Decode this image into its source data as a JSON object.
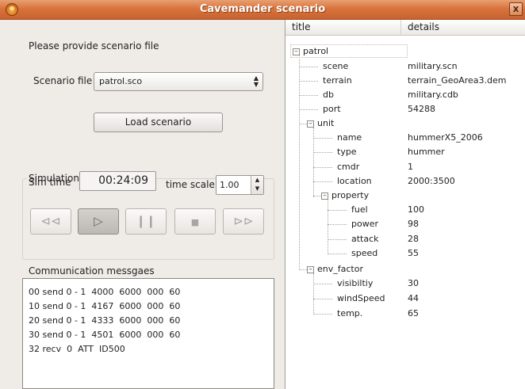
{
  "window": {
    "title": "Cavemander scenario",
    "close_label": "x"
  },
  "left": {
    "prompt": "Please provide scenario file",
    "scenario_label": "Scenario file",
    "scenario_value": "patrol.sco",
    "load_button": "Load scenario",
    "player_title": "Simulation player",
    "sim_time_label": "Sim time",
    "sim_time_value": "00:24:09",
    "time_scale_label": "time scale",
    "time_scale_value": "1.00",
    "comm_title": "Communication messgaes",
    "log_lines": [
      "00 send 0 - 1  4000  6000  000  60",
      "10 send 0 - 1  4167  6000  000  60",
      "20 send 0 - 1  4333  6000  000  60",
      "30 send 0 - 1  4501  6000  000  60",
      "32 recv  0  ATT  ID500"
    ]
  },
  "tree": {
    "headers": {
      "title": "title",
      "details": "details"
    },
    "nodes": {
      "patrol": {
        "title": "patrol",
        "details": ""
      },
      "scene": {
        "title": "scene",
        "details": "military.scn"
      },
      "terrain": {
        "title": "terrain",
        "details": "terrain_GeoArea3.dem"
      },
      "db": {
        "title": "db",
        "details": "military.cdb"
      },
      "port": {
        "title": "port",
        "details": "54288"
      },
      "unit": {
        "title": "unit",
        "details": ""
      },
      "name": {
        "title": "name",
        "details": "hummerX5_2006"
      },
      "type": {
        "title": "type",
        "details": "hummer"
      },
      "cmdr": {
        "title": "cmdr",
        "details": "1"
      },
      "location": {
        "title": "location",
        "details": "2000:3500"
      },
      "property": {
        "title": "property",
        "details": ""
      },
      "fuel": {
        "title": "fuel",
        "details": "100"
      },
      "power": {
        "title": "power",
        "details": "98"
      },
      "attack": {
        "title": "attack",
        "details": "28"
      },
      "speed": {
        "title": "speed",
        "details": "55"
      },
      "env_factor": {
        "title": "env_factor",
        "details": ""
      },
      "visibility": {
        "title": "visibiltiy",
        "details": "30"
      },
      "windspeed": {
        "title": "windSpeed",
        "details": "44"
      },
      "temp": {
        "title": "temp.",
        "details": "65"
      }
    }
  },
  "icons": {
    "rewind": "⊲⊲",
    "play": "▷",
    "pause": "❙❙",
    "stop": "■",
    "fast_forward": "⊳⊳"
  },
  "colors": {
    "titlebar": "#d9733e",
    "window_bg": "#efebe7"
  }
}
